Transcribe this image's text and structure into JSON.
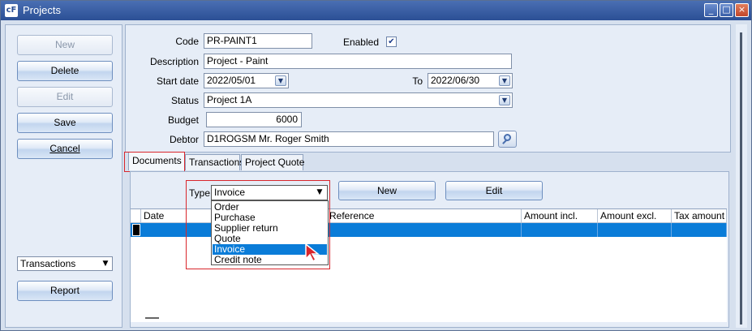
{
  "window": {
    "title": "Projects",
    "icon": "app-logo-icon"
  },
  "left": {
    "buttons": [
      {
        "label": "New",
        "enabled": false
      },
      {
        "label": "Delete",
        "enabled": true
      },
      {
        "label": "Edit",
        "enabled": false
      },
      {
        "label": "Save",
        "enabled": true
      },
      {
        "label": "Cancel",
        "enabled": true
      }
    ],
    "view_select": "Transactions",
    "report_label": "Report"
  },
  "form": {
    "code_label": "Code",
    "code": "PR-PAINT1",
    "enabled_label": "Enabled",
    "enabled": true,
    "description_label": "Description",
    "description": "Project - Paint",
    "start_label": "Start date",
    "start": "2022/05/01",
    "to_label": "To",
    "to": "2022/06/30",
    "status_label": "Status",
    "status": "Project 1A",
    "budget_label": "Budget",
    "budget": "6000",
    "debtor_label": "Debtor",
    "debtor": "D1ROGSM Mr. Roger Smith"
  },
  "tabs": [
    "Documents",
    "Transactions",
    "Project Quote"
  ],
  "documents": {
    "type_label": "Type",
    "type_value": "Invoice",
    "new_label": "New",
    "edit_label": "Edit",
    "type_options": [
      "Order",
      "Purchase",
      "Supplier return",
      "Quote",
      "Invoice",
      "Credit note"
    ],
    "selected_option": "Invoice",
    "columns": [
      "Date",
      "Reference",
      "Amount incl.",
      "Amount excl.",
      "Tax amount"
    ]
  },
  "colors": {
    "accent": "#0a7cd8",
    "highlight": "#d9262c",
    "titlebar": "#2b4f95"
  }
}
